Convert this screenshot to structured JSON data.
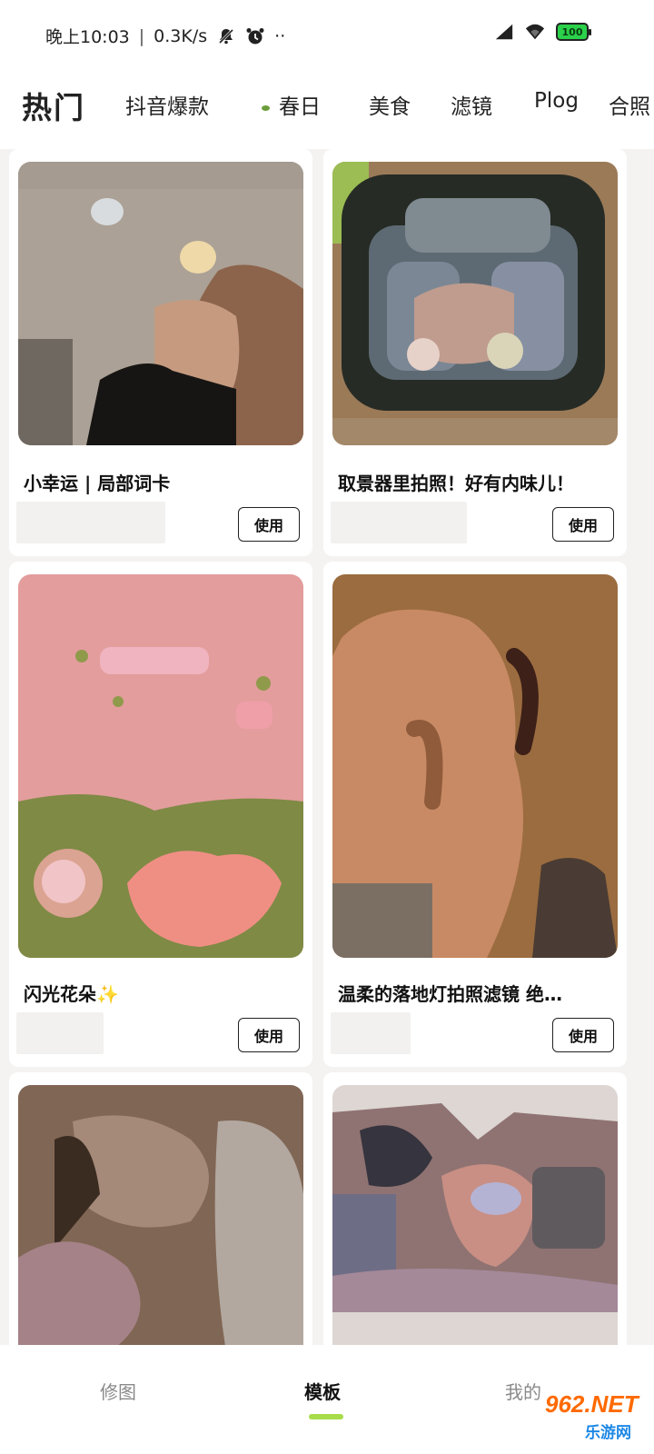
{
  "status_bar": {
    "time": "晚上10:03",
    "network_speed": "0.3K/s",
    "more": "··",
    "battery": "100"
  },
  "tabs": [
    {
      "label": "热门",
      "active": true
    },
    {
      "label": "抖音爆款"
    },
    {
      "label": "春日"
    },
    {
      "label": "美食"
    },
    {
      "label": "滤镜"
    },
    {
      "label": "Plog"
    },
    {
      "label": "合照"
    }
  ],
  "cards": [
    {
      "title": "小幸运 | 局部词卡",
      "button": "使用"
    },
    {
      "title": "取景器里拍照！好有内味儿！",
      "button": "使用"
    },
    {
      "title": "闪光花朵✨",
      "button": "使用"
    },
    {
      "title": "温柔的落地灯拍照滤镜  绝…",
      "button": "使用"
    },
    {
      "title": ""
    },
    {
      "title": ""
    }
  ],
  "bottom_nav": {
    "items": [
      {
        "label": "修图"
      },
      {
        "label": "模板",
        "active": true
      },
      {
        "label": "我的"
      }
    ]
  },
  "watermark": {
    "line1": "962.NET",
    "line2": "乐游网"
  },
  "colors": {
    "accent": "#a7dc4a",
    "background": "#f4f3f1",
    "battery": "#2bd14a"
  }
}
